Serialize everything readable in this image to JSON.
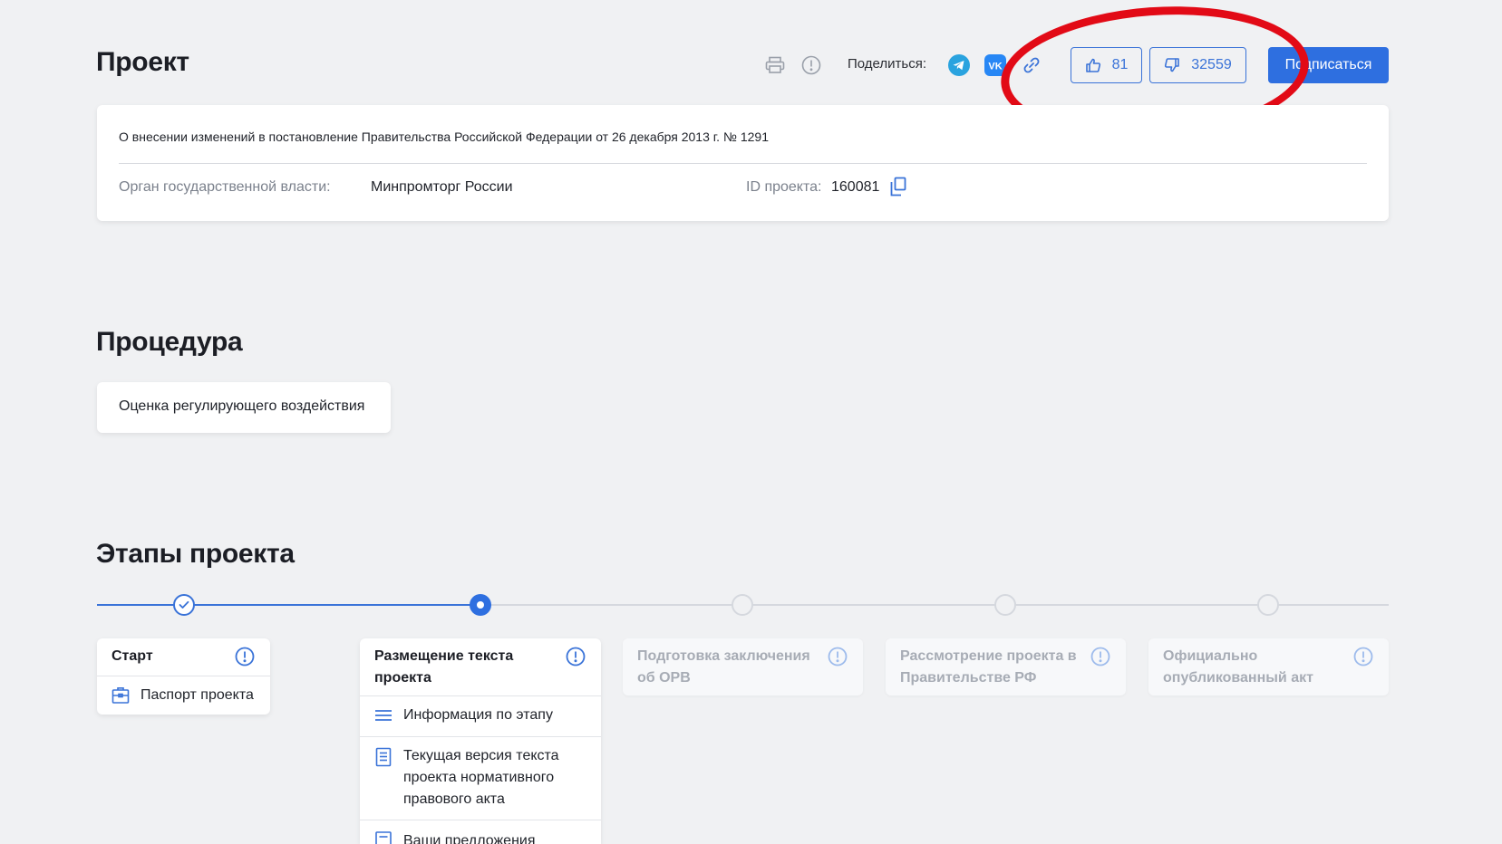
{
  "header": {
    "title": "Проект",
    "share_label": "Поделиться:",
    "likes": "81",
    "dislikes": "32559",
    "subscribe_label": "Подписаться"
  },
  "project": {
    "description": "О внесении изменений в постановление Правительства Российской Федерации от 26 декабря 2013 г. № 1291",
    "authority_label": "Орган государственной власти:",
    "authority_value": "Минпромторг России",
    "id_label": "ID проекта:",
    "id_value": "160081"
  },
  "procedure": {
    "title": "Процедура",
    "value": "Оценка регулирующего воздействия"
  },
  "stages": {
    "title": "Этапы проекта",
    "items": [
      {
        "title": "Старт",
        "status": "done",
        "links": [
          "Паспорт проекта"
        ]
      },
      {
        "title": "Размещение текста проекта",
        "status": "current",
        "links": [
          "Информация по этапу",
          "Текущая версия текста проекта нормативного правового акта",
          "Ваши предложения"
        ]
      },
      {
        "title": "Подготовка заключения об ОРВ",
        "status": "pending"
      },
      {
        "title": "Рассмотрение проекта в Правительстве РФ",
        "status": "pending"
      },
      {
        "title": "Официально опубликованный акт",
        "status": "pending"
      }
    ]
  },
  "colors": {
    "accent": "#2e6fe0",
    "annotation": "#e20a16",
    "background": "#f0f1f3"
  },
  "icons": [
    "print-icon",
    "info-icon",
    "telegram-icon",
    "vk-icon",
    "link-icon",
    "thumbs-up-icon",
    "thumbs-down-icon",
    "copy-icon",
    "check-icon",
    "passport-icon",
    "list-icon",
    "document-icon"
  ]
}
